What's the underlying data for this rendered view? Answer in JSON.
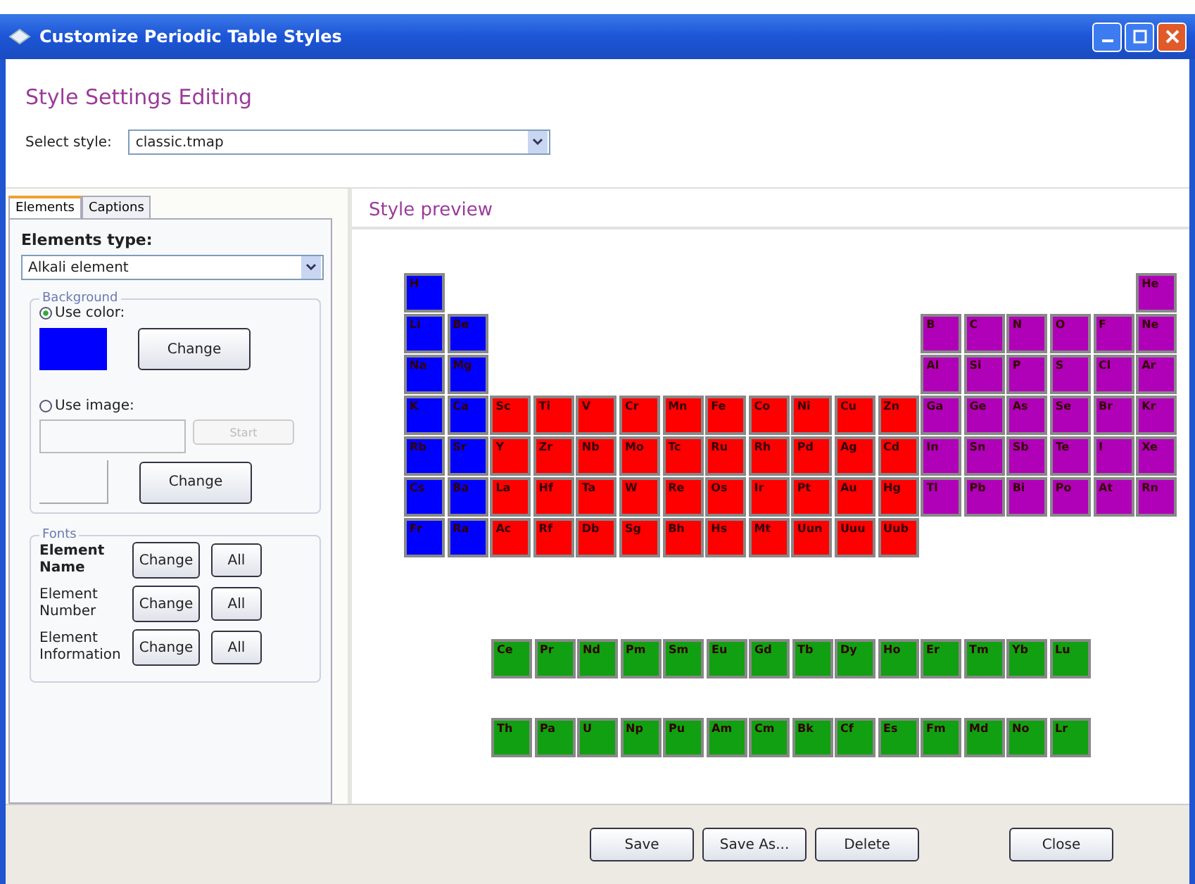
{
  "window": {
    "title": "Customize Periodic Table Styles"
  },
  "heading": "Style Settings Editing",
  "style_select": {
    "label": "Select style:",
    "value": "classic.tmap"
  },
  "tabs": [
    {
      "label": "Elements",
      "selected": true
    },
    {
      "label": "Captions",
      "selected": false
    }
  ],
  "elements_type": {
    "label": "Elements type:",
    "value": "Alkali element"
  },
  "background": {
    "title": "Background",
    "use_color": {
      "label": "Use color:",
      "selected": true
    },
    "color": "#0000ff",
    "color_button": "Change",
    "use_image": {
      "label": "Use image:",
      "selected": false
    },
    "image_button": "Start",
    "image_button_disabled": true,
    "change_image_button": "Change"
  },
  "fonts": {
    "title": "Fonts",
    "rows": [
      {
        "label": "Element Name",
        "bold": true,
        "change": "Change",
        "all": "All"
      },
      {
        "label": "Element Number",
        "bold": false,
        "change": "Change",
        "all": "All"
      },
      {
        "label": "Element Information",
        "bold": false,
        "change": "Change",
        "all": "All"
      }
    ]
  },
  "preview": {
    "title": "Style preview",
    "rows": [
      {
        "left": [
          {
            "symbol": "H",
            "color": "#0000ff"
          }
        ],
        "right": [
          {
            "symbol": "He",
            "color": "#b000b8"
          }
        ]
      },
      {
        "left": [
          {
            "symbol": "Li",
            "color": "#0000ff"
          },
          {
            "symbol": "Be",
            "color": "#0000ff"
          }
        ],
        "right": [
          {
            "symbol": "B",
            "color": "#b000b8"
          },
          {
            "symbol": "C",
            "color": "#b000b8"
          },
          {
            "symbol": "N",
            "color": "#b000b8"
          },
          {
            "symbol": "O",
            "color": "#b000b8"
          },
          {
            "symbol": "F",
            "color": "#b000b8"
          },
          {
            "symbol": "Ne",
            "color": "#b000b8"
          }
        ]
      },
      {
        "left": [
          {
            "symbol": "Na",
            "color": "#0000ff"
          },
          {
            "symbol": "Mg",
            "color": "#0000ff"
          }
        ],
        "right": [
          {
            "symbol": "Al",
            "color": "#b000b8"
          },
          {
            "symbol": "Si",
            "color": "#b000b8"
          },
          {
            "symbol": "P",
            "color": "#b000b8"
          },
          {
            "symbol": "S",
            "color": "#b000b8"
          },
          {
            "symbol": "Cl",
            "color": "#b000b8"
          },
          {
            "symbol": "Ar",
            "color": "#b000b8"
          }
        ]
      },
      {
        "left": [
          {
            "symbol": "K",
            "color": "#0000ff"
          },
          {
            "symbol": "Ca",
            "color": "#0000ff"
          },
          {
            "symbol": "Sc",
            "color": "#ff0000"
          },
          {
            "symbol": "Ti",
            "color": "#ff0000"
          },
          {
            "symbol": "V",
            "color": "#ff0000"
          },
          {
            "symbol": "Cr",
            "color": "#ff0000"
          },
          {
            "symbol": "Mn",
            "color": "#ff0000"
          },
          {
            "symbol": "Fe",
            "color": "#ff0000"
          },
          {
            "symbol": "Co",
            "color": "#ff0000"
          },
          {
            "symbol": "Ni",
            "color": "#ff0000"
          },
          {
            "symbol": "Cu",
            "color": "#ff0000"
          },
          {
            "symbol": "Zn",
            "color": "#ff0000"
          }
        ],
        "right": [
          {
            "symbol": "Ga",
            "color": "#b000b8"
          },
          {
            "symbol": "Ge",
            "color": "#b000b8"
          },
          {
            "symbol": "As",
            "color": "#b000b8"
          },
          {
            "symbol": "Se",
            "color": "#b000b8"
          },
          {
            "symbol": "Br",
            "color": "#b000b8"
          },
          {
            "symbol": "Kr",
            "color": "#b000b8"
          }
        ]
      },
      {
        "left": [
          {
            "symbol": "Rb",
            "color": "#0000ff"
          },
          {
            "symbol": "Sr",
            "color": "#0000ff"
          },
          {
            "symbol": "Y",
            "color": "#ff0000"
          },
          {
            "symbol": "Zr",
            "color": "#ff0000"
          },
          {
            "symbol": "Nb",
            "color": "#ff0000"
          },
          {
            "symbol": "Mo",
            "color": "#ff0000"
          },
          {
            "symbol": "Tc",
            "color": "#ff0000"
          },
          {
            "symbol": "Ru",
            "color": "#ff0000"
          },
          {
            "symbol": "Rh",
            "color": "#ff0000"
          },
          {
            "symbol": "Pd",
            "color": "#ff0000"
          },
          {
            "symbol": "Ag",
            "color": "#ff0000"
          },
          {
            "symbol": "Cd",
            "color": "#ff0000"
          }
        ],
        "right": [
          {
            "symbol": "In",
            "color": "#b000b8"
          },
          {
            "symbol": "Sn",
            "color": "#b000b8"
          },
          {
            "symbol": "Sb",
            "color": "#b000b8"
          },
          {
            "symbol": "Te",
            "color": "#b000b8"
          },
          {
            "symbol": "I",
            "color": "#b000b8"
          },
          {
            "symbol": "Xe",
            "color": "#b000b8"
          }
        ]
      },
      {
        "left": [
          {
            "symbol": "Cs",
            "color": "#0000ff"
          },
          {
            "symbol": "Ba",
            "color": "#0000ff"
          },
          {
            "symbol": "La",
            "color": "#ff0000"
          },
          {
            "symbol": "Hf",
            "color": "#ff0000"
          },
          {
            "symbol": "Ta",
            "color": "#ff0000"
          },
          {
            "symbol": "W",
            "color": "#ff0000"
          },
          {
            "symbol": "Re",
            "color": "#ff0000"
          },
          {
            "symbol": "Os",
            "color": "#ff0000"
          },
          {
            "symbol": "Ir",
            "color": "#ff0000"
          },
          {
            "symbol": "Pt",
            "color": "#ff0000"
          },
          {
            "symbol": "Au",
            "color": "#ff0000"
          },
          {
            "symbol": "Hg",
            "color": "#ff0000"
          }
        ],
        "right": [
          {
            "symbol": "Tl",
            "color": "#b000b8"
          },
          {
            "symbol": "Pb",
            "color": "#b000b8"
          },
          {
            "symbol": "Bi",
            "color": "#b000b8"
          },
          {
            "symbol": "Po",
            "color": "#b000b8"
          },
          {
            "symbol": "At",
            "color": "#b000b8"
          },
          {
            "symbol": "Rn",
            "color": "#b000b8"
          }
        ]
      },
      {
        "left": [
          {
            "symbol": "Fr",
            "color": "#0000ff"
          },
          {
            "symbol": "Ra",
            "color": "#0000ff"
          },
          {
            "symbol": "Ac",
            "color": "#ff0000"
          },
          {
            "symbol": "Rf",
            "color": "#ff0000"
          },
          {
            "symbol": "Db",
            "color": "#ff0000"
          },
          {
            "symbol": "Sg",
            "color": "#ff0000"
          },
          {
            "symbol": "Bh",
            "color": "#ff0000"
          },
          {
            "symbol": "Hs",
            "color": "#ff0000"
          },
          {
            "symbol": "Mt",
            "color": "#ff0000"
          },
          {
            "symbol": "Uun",
            "color": "#ff0000"
          },
          {
            "symbol": "Uuu",
            "color": "#ff0000"
          },
          {
            "symbol": "Uub",
            "color": "#ff0000"
          }
        ],
        "right": []
      }
    ],
    "f_rows": [
      [
        {
          "symbol": "Ce",
          "color": "#11a011"
        },
        {
          "symbol": "Pr",
          "color": "#11a011"
        },
        {
          "symbol": "Nd",
          "color": "#11a011"
        },
        {
          "symbol": "Pm",
          "color": "#11a011"
        },
        {
          "symbol": "Sm",
          "color": "#11a011"
        },
        {
          "symbol": "Eu",
          "color": "#11a011"
        },
        {
          "symbol": "Gd",
          "color": "#11a011"
        },
        {
          "symbol": "Tb",
          "color": "#11a011"
        },
        {
          "symbol": "Dy",
          "color": "#11a011"
        },
        {
          "symbol": "Ho",
          "color": "#11a011"
        },
        {
          "symbol": "Er",
          "color": "#11a011"
        },
        {
          "symbol": "Tm",
          "color": "#11a011"
        },
        {
          "symbol": "Yb",
          "color": "#11a011"
        },
        {
          "symbol": "Lu",
          "color": "#11a011"
        }
      ],
      [
        {
          "symbol": "Th",
          "color": "#11a011"
        },
        {
          "symbol": "Pa",
          "color": "#11a011"
        },
        {
          "symbol": "U",
          "color": "#11a011"
        },
        {
          "symbol": "Np",
          "color": "#11a011"
        },
        {
          "symbol": "Pu",
          "color": "#11a011"
        },
        {
          "symbol": "Am",
          "color": "#11a011"
        },
        {
          "symbol": "Cm",
          "color": "#11a011"
        },
        {
          "symbol": "Bk",
          "color": "#11a011"
        },
        {
          "symbol": "Cf",
          "color": "#11a011"
        },
        {
          "symbol": "Es",
          "color": "#11a011"
        },
        {
          "symbol": "Fm",
          "color": "#11a011"
        },
        {
          "symbol": "Md",
          "color": "#11a011"
        },
        {
          "symbol": "No",
          "color": "#11a011"
        },
        {
          "symbol": "Lr",
          "color": "#11a011"
        }
      ]
    ]
  },
  "buttons": [
    "Save",
    "Save As...",
    "Delete"
  ],
  "close_button": "Close"
}
